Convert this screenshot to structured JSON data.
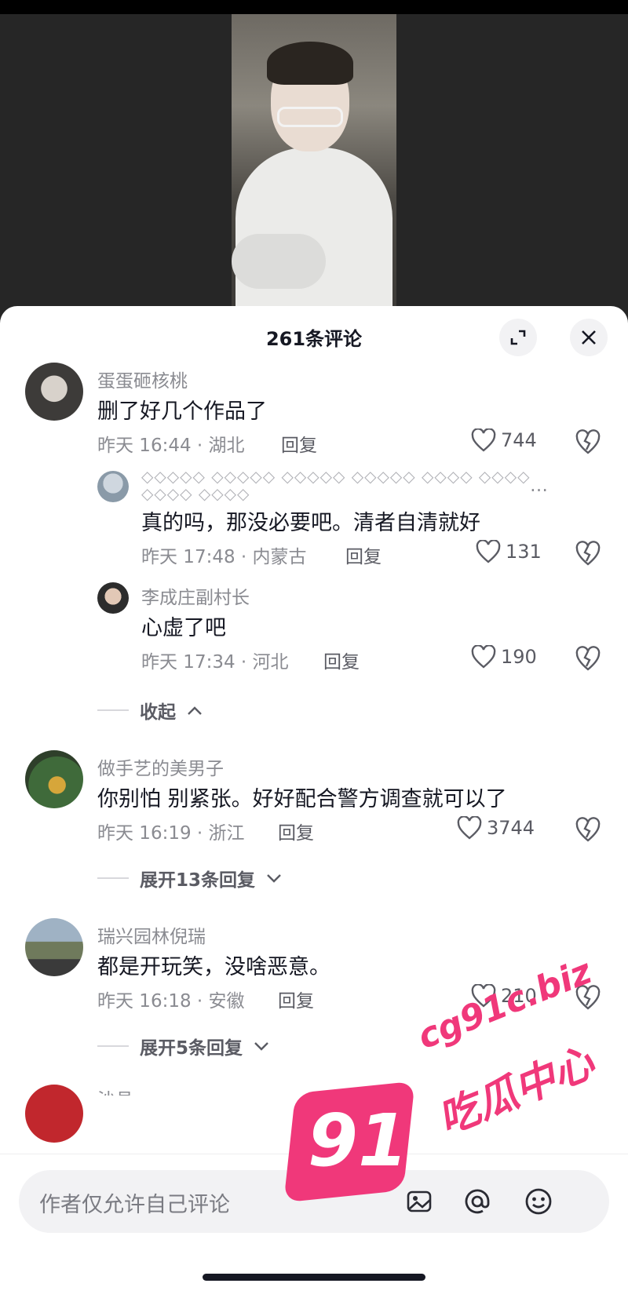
{
  "header": {
    "title": "261条评论"
  },
  "comments": [
    {
      "user": "蛋蛋砸核桃",
      "text": "删了好几个作品了",
      "time": "昨天 16:44 · 湖北",
      "reply": "回复",
      "likes": "744"
    },
    {
      "user": "做手艺的美男子",
      "text": "你别怕 别紧张。好好配合警方调查就可以了",
      "time": "昨天 16:19 · 浙江",
      "reply": "回复",
      "likes": "3744"
    },
    {
      "user": "瑞兴园林倪瑞",
      "text": "都是开玩笑，没啥恶意。",
      "time": "昨天 16:18 · 安徽",
      "reply": "回复",
      "likes": "210"
    }
  ],
  "replies": [
    {
      "user_glyphs": "◇◇◇◇◇ ◇◇◇◇◇ ◇◇◇◇◇ ◇◇◇◇◇ ◇◇◇◇ ◇◇◇◇ ◇◇◇◇ ◇◇◇◇",
      "ellipsis": "…",
      "text": "真的吗，那没必要吧。清者自清就好",
      "time": "昨天 17:48 · 内蒙古",
      "reply": "回复",
      "likes": "131"
    },
    {
      "user": "李成庄副村长",
      "text": "心虚了吧",
      "time": "昨天 17:34 · 河北",
      "reply": "回复",
      "likes": "190"
    }
  ],
  "toggles": {
    "collapse": "收起",
    "expand_1": "展开13条回复",
    "expand_2": "展开5条回复"
  },
  "partial_next_user": "沙县...",
  "input": {
    "placeholder": "作者仅允许自己评论"
  },
  "watermark": {
    "number": "91",
    "url": "cg91c.biz",
    "text": "吃瓜中心"
  },
  "colors": {
    "accent": "#f0387a",
    "text_primary": "#161823",
    "text_secondary": "#8a8b91",
    "sheet_bg": "#ffffff"
  }
}
